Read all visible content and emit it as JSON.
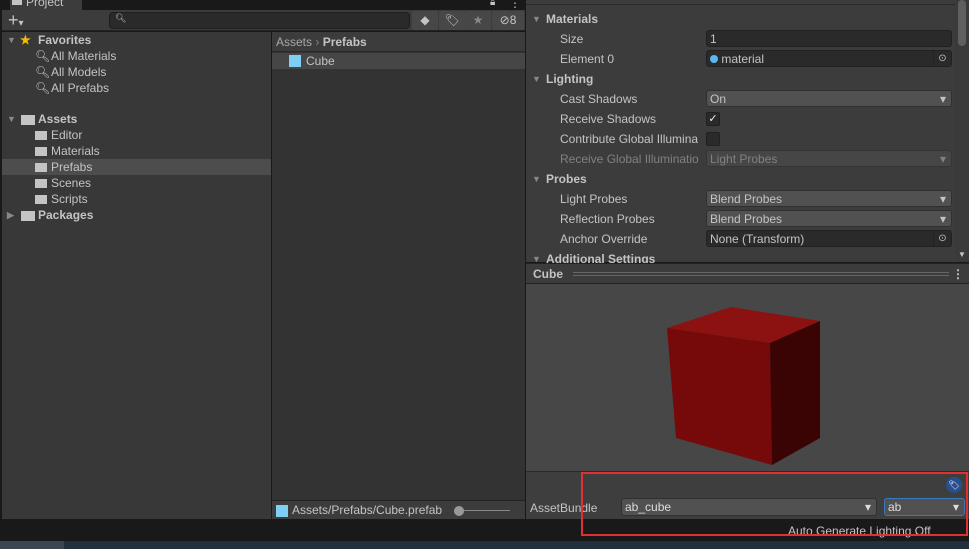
{
  "project": {
    "tab": "Project",
    "hidden_count": "8",
    "favorites": {
      "label": "Favorites",
      "items": [
        "All Materials",
        "All Models",
        "All Prefabs"
      ]
    },
    "assets": {
      "label": "Assets",
      "items": [
        "Editor",
        "Materials",
        "Prefabs",
        "Scenes",
        "Scripts"
      ],
      "selected": "Prefabs"
    },
    "packages": "Packages",
    "breadcrumb": [
      "Assets",
      "Prefabs"
    ],
    "files": [
      "Cube"
    ],
    "status_path": "Assets/Prefabs/Cube.prefab"
  },
  "inspector": {
    "materials": {
      "header": "Materials",
      "size_label": "Size",
      "size": "1",
      "element_label": "Element 0",
      "element": "material"
    },
    "lighting": {
      "header": "Lighting",
      "cast_label": "Cast Shadows",
      "cast": "On",
      "receive_label": "Receive Shadows",
      "receive_checked": true,
      "contribute_label": "Contribute Global Illumina",
      "contribute_checked": false,
      "rgi_label": "Receive Global Illuminatio",
      "rgi": "Light Probes"
    },
    "probes": {
      "header": "Probes",
      "light_label": "Light Probes",
      "light": "Blend Probes",
      "refl_label": "Reflection Probes",
      "refl": "Blend Probes",
      "anchor_label": "Anchor Override",
      "anchor": "None (Transform)"
    },
    "additional": "Additional Settings"
  },
  "preview": {
    "title": "Cube",
    "cube_color": "#7a0a0a"
  },
  "assetbundle": {
    "label": "AssetBundle",
    "name": "ab_cube",
    "variant": "ab"
  },
  "footer": {
    "lighting": "Auto Generate Lighting Off"
  },
  "highlight_color": "#e03030"
}
